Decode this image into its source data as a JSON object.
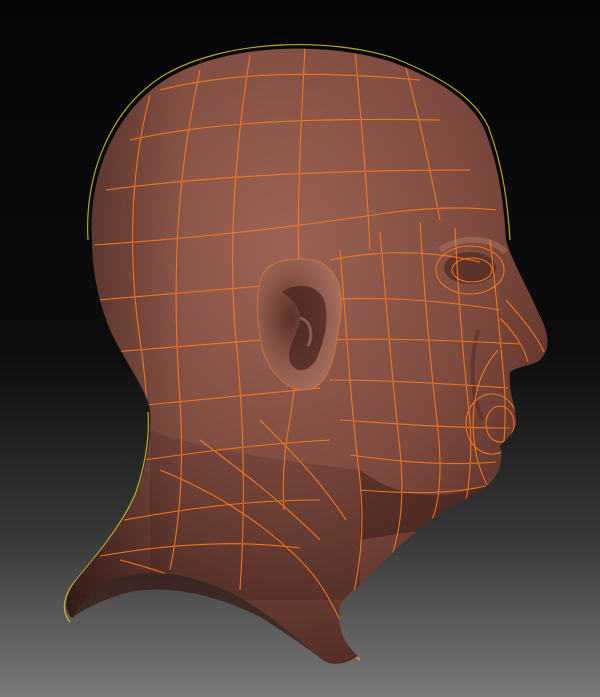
{
  "viewport": {
    "label": "",
    "background_top_color": "#050505",
    "background_bottom_color": "#7a7a7a"
  },
  "model": {
    "name": "",
    "material_color": "#8a5448",
    "wireframe_color": "#ff7a1a",
    "selection_outline_color": "#e8d020",
    "view": "side-profile-right"
  }
}
